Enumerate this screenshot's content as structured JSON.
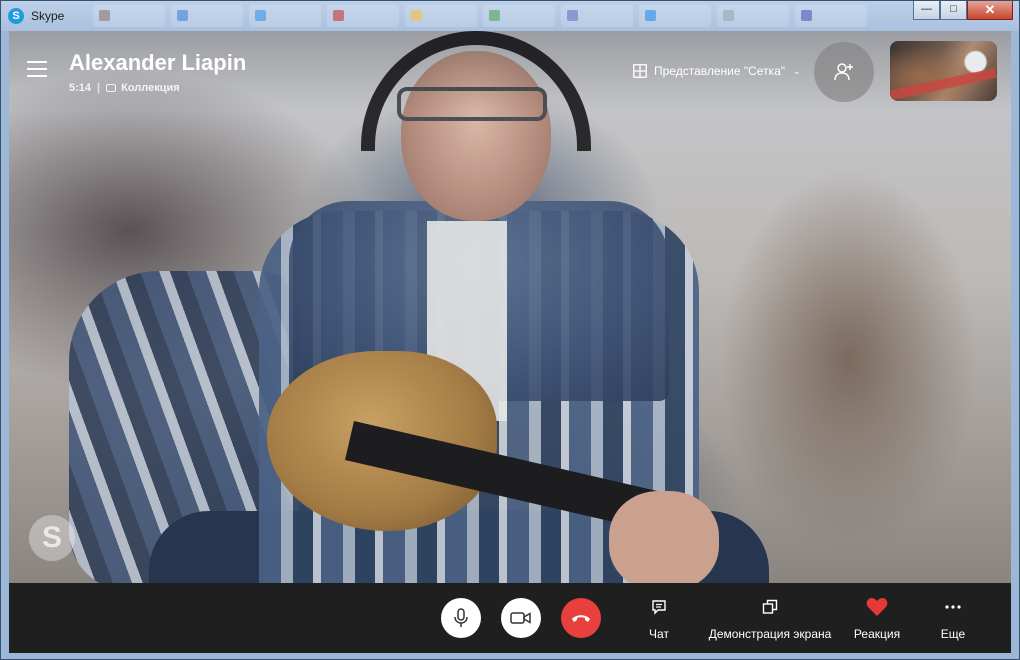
{
  "window": {
    "title": "Skype",
    "app_icon_letter": "S",
    "minimize_label": "—",
    "maximize_label": "□",
    "close_label": "✕"
  },
  "call": {
    "caller_name": "Alexander Liapin",
    "duration": "5:14",
    "separator": "|",
    "collection_label": "Коллекция",
    "view_mode_label": "Представление \"Сетка\""
  },
  "controls": {
    "chat_label": "Чат",
    "screen_share_label": "Демонстрация экрана",
    "reaction_label": "Реакция",
    "more_label": "Еще"
  },
  "colors": {
    "hangup": "#e8403c",
    "reaction_heart": "#e53935",
    "control_bar": "#1f1f1f",
    "skype_blue": "#1e9ce0"
  },
  "watermark_letter": "S"
}
